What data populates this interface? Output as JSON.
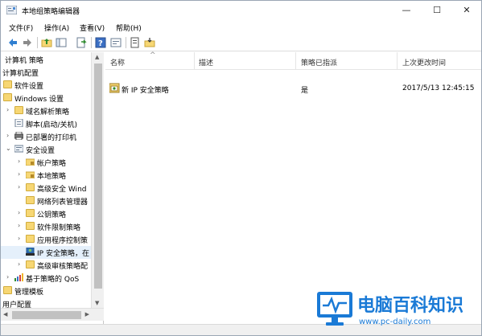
{
  "window": {
    "title": "本地组策略编辑器",
    "controls": {
      "minimize": "—",
      "maximize": "☐",
      "close": "✕"
    }
  },
  "menu": [
    "文件(F)",
    "操作(A)",
    "查看(V)",
    "帮助(H)"
  ],
  "toolbar_icons": [
    "back-arrow-icon",
    "forward-arrow-icon",
    "folder-up-icon",
    "show-tree-icon",
    "export-list-icon",
    "help-icon",
    "properties-icon",
    "policy-export-icon",
    "policy-import-icon"
  ],
  "tree": [
    {
      "label": "计算机 策略",
      "indent": 0,
      "icon": "none",
      "expander": ""
    },
    {
      "label": "计算机配置",
      "indent": 0,
      "icon": "none",
      "expander": ""
    },
    {
      "label": "软件设置",
      "indent": 1,
      "icon": "folder",
      "expander": ""
    },
    {
      "label": "Windows 设置",
      "indent": 1,
      "icon": "folder",
      "expander": ""
    },
    {
      "label": "域名解析策略",
      "indent": 2,
      "icon": "folder",
      "expander": "›"
    },
    {
      "label": "脚本(启动/关机)",
      "indent": 2,
      "icon": "script",
      "expander": ""
    },
    {
      "label": "已部署的打印机",
      "indent": 2,
      "icon": "printer",
      "expander": "›"
    },
    {
      "label": "安全设置",
      "indent": 2,
      "icon": "security",
      "expander": "⌄"
    },
    {
      "label": "帐户策略",
      "indent": 3,
      "icon": "folder-lock",
      "expander": "›"
    },
    {
      "label": "本地策略",
      "indent": 3,
      "icon": "folder-lock",
      "expander": "›"
    },
    {
      "label": "高级安全 Wind",
      "indent": 3,
      "icon": "folder",
      "expander": "›"
    },
    {
      "label": "网络列表管理器",
      "indent": 3,
      "icon": "folder",
      "expander": ""
    },
    {
      "label": "公钥策略",
      "indent": 3,
      "icon": "folder",
      "expander": "›"
    },
    {
      "label": "软件限制策略",
      "indent": 3,
      "icon": "folder",
      "expander": "›"
    },
    {
      "label": "应用程序控制策",
      "indent": 3,
      "icon": "folder",
      "expander": "›"
    },
    {
      "label": "IP 安全策略，在",
      "indent": 3,
      "icon": "ip-policy",
      "expander": "",
      "selected": true
    },
    {
      "label": "高级审核策略配",
      "indent": 3,
      "icon": "folder",
      "expander": "›"
    },
    {
      "label": "基于策略的 QoS",
      "indent": 1,
      "icon": "chart",
      "expander": "›"
    },
    {
      "label": "管理模板",
      "indent": 0,
      "icon": "folder",
      "expander": ""
    },
    {
      "label": "用户配置",
      "indent": 0,
      "icon": "none",
      "expander": ""
    }
  ],
  "list": {
    "columns": [
      "名称",
      "描述",
      "策略已指派",
      "上次更改时间"
    ],
    "rows": [
      {
        "name": "新 IP 安全策略",
        "description": "",
        "assigned": "是",
        "modified": "2017/5/13 12:45:15"
      }
    ]
  },
  "watermark": {
    "name": "电脑百科知识",
    "url": "www.pc-daily.com"
  },
  "colors": {
    "accent": "#1a7ad6",
    "folder": "#f7d774",
    "selected_row": "#e5f0fb"
  }
}
